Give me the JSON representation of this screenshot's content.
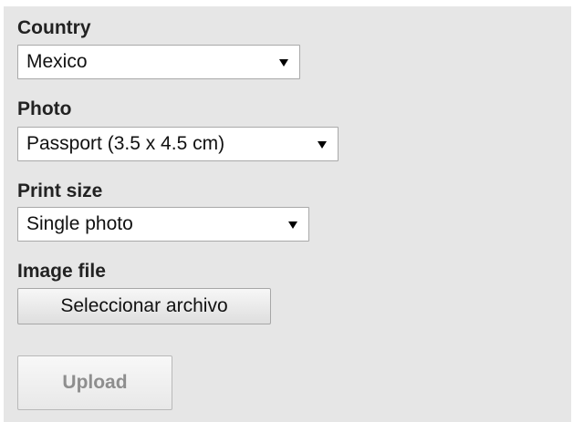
{
  "form": {
    "country": {
      "label": "Country",
      "selected": "Mexico"
    },
    "photo": {
      "label": "Photo",
      "selected": "Passport (3.5 x 4.5 cm)"
    },
    "print_size": {
      "label": "Print size",
      "selected": "Single photo"
    },
    "image_file": {
      "label": "Image file",
      "button_label": "Seleccionar archivo"
    },
    "upload": {
      "label": "Upload",
      "disabled": true
    }
  },
  "colors": {
    "panel_background": "#e6e6e6",
    "label_text": "#222222",
    "disabled_text": "#8e8e8e"
  },
  "icons": {
    "dropdown": "chevron-down-icon"
  }
}
